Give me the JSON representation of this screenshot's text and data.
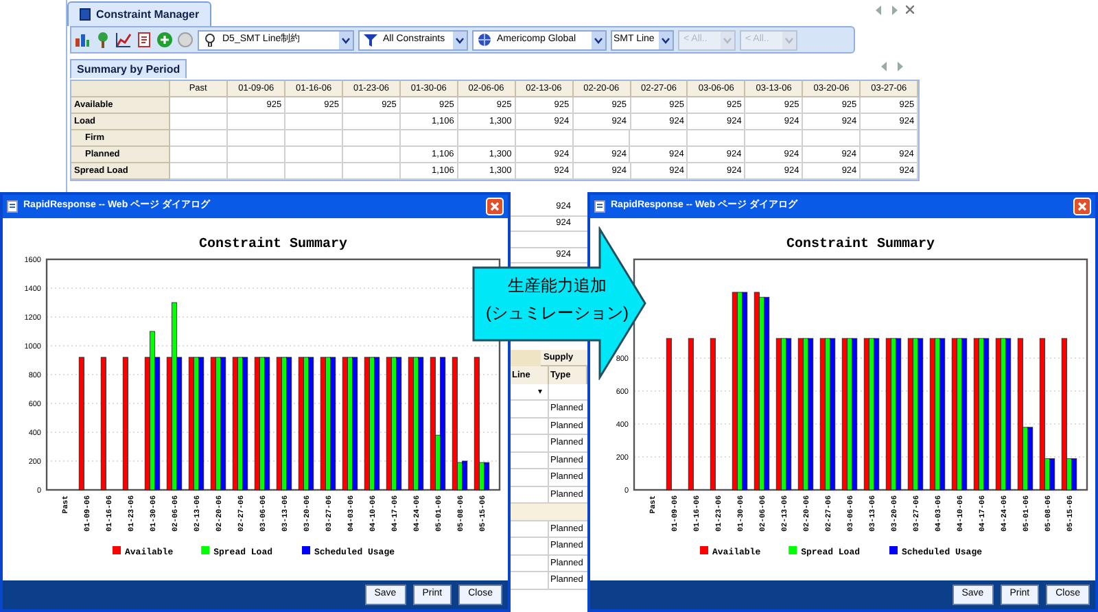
{
  "main_window": {
    "tabs": [
      {
        "label": "Constraint Manager",
        "selected": true
      }
    ],
    "toolbar": {
      "dropdowns": [
        {
          "label": "D5_SMT Line制約",
          "disabled": false
        },
        {
          "label": "All Constraints",
          "disabled": false
        },
        {
          "label": "Americomp Global",
          "disabled": false
        },
        {
          "label": "SMT Line",
          "disabled": false
        },
        {
          "label": "< All..",
          "disabled": true
        },
        {
          "label": "< All..",
          "disabled": true
        }
      ]
    },
    "view_tabs": [
      {
        "label": "Summary by Period",
        "selected": true
      }
    ],
    "table": {
      "columns": [
        "Past",
        "01-09-06",
        "01-16-06",
        "01-23-06",
        "01-30-06",
        "02-06-06",
        "02-13-06",
        "02-20-06",
        "02-27-06",
        "03-06-06",
        "03-13-06",
        "03-20-06",
        "03-27-06"
      ],
      "rows": [
        {
          "label": "Available",
          "cells": [
            null,
            "925",
            "925",
            "925",
            "925",
            "925",
            "925",
            "925",
            "925",
            "925",
            "925",
            "925",
            "925"
          ]
        },
        {
          "label": "Load",
          "cells": [
            null,
            null,
            null,
            null,
            "1,106",
            "1,300",
            "924",
            "924",
            "924",
            "924",
            "924",
            "924",
            "924"
          ],
          "children": [
            {
              "label": "Firm"
            },
            {
              "label": "Planned",
              "cells": [
                null,
                null,
                null,
                null,
                "1,106",
                "1,300",
                "924",
                "924",
                "924",
                "924",
                "924",
                "924",
                "924"
              ]
            }
          ]
        },
        {
          "label": "Spread Load",
          "cells": [
            null,
            null,
            null,
            null,
            "1,106",
            "1,300",
            "924",
            "924",
            "924",
            "924",
            "924",
            "924",
            "924"
          ]
        }
      ]
    },
    "table_fragment": {
      "upper_cells": [
        "924",
        "924",
        null,
        "924"
      ],
      "header": "Supply",
      "columns": [
        "Line",
        "Type"
      ],
      "filter_mark": "▾",
      "rows": [
        {
          "kind": "cell",
          "text": "Planned"
        },
        {
          "kind": "cell",
          "text": "Planned"
        },
        {
          "kind": "cell",
          "text": "Planned"
        },
        {
          "kind": "cell",
          "text": "Planned"
        },
        {
          "kind": "cell",
          "text": "Planned"
        },
        {
          "kind": "cell",
          "text": "Planned"
        },
        {
          "kind": "band"
        },
        {
          "kind": "cell",
          "text": "Planned"
        },
        {
          "kind": "cell",
          "text": "Planned"
        },
        {
          "kind": "cell",
          "text": "Planned"
        },
        {
          "kind": "cell",
          "text": "Planned"
        }
      ]
    }
  },
  "dialogs": [
    {
      "title": "RapidResponse -- Web ページ ダイアログ",
      "buttons": [
        "Save",
        "Print",
        "Close"
      ],
      "chart_data": {
        "type": "bar",
        "title": "Constraint Summary",
        "grid": true,
        "legend": true,
        "categories": [
          "Past",
          "01-09-06",
          "01-16-06",
          "01-23-06",
          "01-30-06",
          "02-06-06",
          "02-13-06",
          "02-20-06",
          "02-27-06",
          "03-06-06",
          "03-13-06",
          "03-20-06",
          "03-27-06",
          "04-03-06",
          "04-10-06",
          "04-17-06",
          "04-24-06",
          "05-01-06",
          "05-08-06",
          "05-15-06"
        ],
        "ylim": [
          0,
          1600
        ],
        "yticks": [
          {
            "value": 0,
            "label": "0"
          },
          {
            "value": 200,
            "label": "200"
          },
          {
            "value": 400,
            "label": "400"
          },
          {
            "value": 600,
            "label": "600"
          },
          {
            "value": 800,
            "label": "800"
          },
          {
            "value": 1000,
            "label": "1000"
          },
          {
            "value": 1200,
            "label": "1200"
          },
          {
            "value": 1400,
            "label": "1400"
          },
          {
            "value": 1600,
            "label": "1600"
          }
        ],
        "series": [
          {
            "name": "Available",
            "color": "#ff0000",
            "values": [
              null,
              920,
              920,
              920,
              920,
              920,
              920,
              920,
              920,
              920,
              920,
              920,
              920,
              920,
              920,
              920,
              920,
              920,
              920,
              920
            ]
          },
          {
            "name": "Spread Load",
            "color": "#00ff00",
            "values": [
              null,
              null,
              null,
              null,
              1100,
              1300,
              920,
              920,
              920,
              920,
              920,
              920,
              920,
              920,
              920,
              920,
              920,
              380,
              190,
              190
            ]
          },
          {
            "name": "Scheduled Usage",
            "color": "#0000ff",
            "values": [
              null,
              null,
              null,
              null,
              920,
              920,
              920,
              920,
              920,
              920,
              920,
              920,
              920,
              920,
              920,
              920,
              920,
              920,
              200,
              190
            ]
          }
        ]
      }
    },
    {
      "title": "RapidResponse -- Web ページ ダイアログ",
      "buttons": [
        "Save",
        "Print",
        "Close"
      ],
      "chart_data": {
        "type": "bar",
        "title": "Constraint Summary",
        "grid": true,
        "legend": true,
        "categories": [
          "Past",
          "01-09-06",
          "01-16-06",
          "01-23-06",
          "01-30-06",
          "02-06-06",
          "02-13-06",
          "02-20-06",
          "02-27-06",
          "03-06-06",
          "03-13-06",
          "03-20-06",
          "03-27-06",
          "04-03-06",
          "04-10-06",
          "04-17-06",
          "04-24-06",
          "05-01-06",
          "05-08-06",
          "05-15-06"
        ],
        "ylim": [
          0,
          1400
        ],
        "yticks": [
          {
            "value": 0,
            "label": "0"
          },
          {
            "value": 200,
            "label": "200"
          },
          {
            "value": 400,
            "label": "400"
          },
          {
            "value": 600,
            "label": "600"
          },
          {
            "value": 800,
            "label": "800"
          }
        ],
        "series": [
          {
            "name": "Available",
            "color": "#ff0000",
            "values": [
              null,
              920,
              920,
              920,
              1200,
              1200,
              920,
              920,
              920,
              920,
              920,
              920,
              920,
              920,
              920,
              920,
              920,
              920,
              920,
              920
            ]
          },
          {
            "name": "Spread Load",
            "color": "#00ff00",
            "values": [
              null,
              null,
              null,
              null,
              1200,
              1170,
              920,
              920,
              920,
              920,
              920,
              920,
              920,
              920,
              920,
              920,
              920,
              380,
              190,
              190
            ]
          },
          {
            "name": "Scheduled Usage",
            "color": "#0000ff",
            "values": [
              null,
              null,
              null,
              null,
              1200,
              1170,
              920,
              920,
              920,
              920,
              920,
              920,
              920,
              920,
              920,
              920,
              920,
              380,
              190,
              190
            ]
          }
        ]
      }
    }
  ],
  "callout": {
    "lines": [
      "生産能力追加",
      "(シュミレーション)"
    ]
  }
}
